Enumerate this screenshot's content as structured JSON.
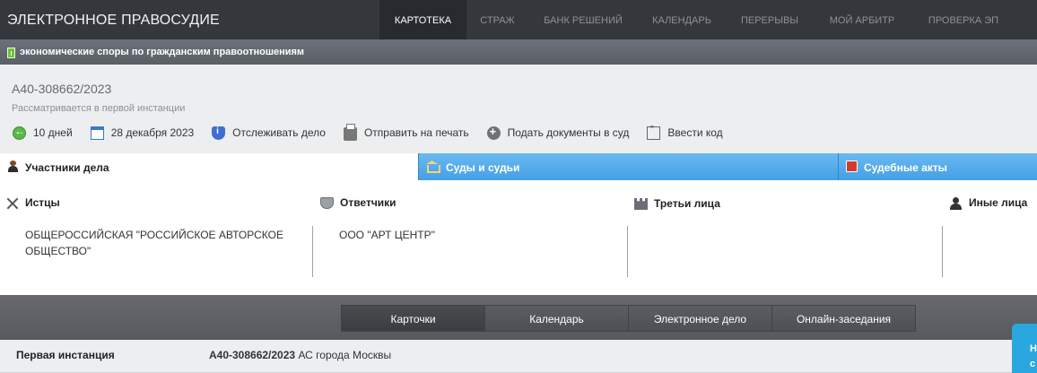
{
  "header": {
    "brand": "ЭЛЕКТРОННОЕ ПРАВОСУДИЕ",
    "nav": [
      {
        "label": "КАРТОТЕКА",
        "active": true
      },
      {
        "label": "СТРАЖ",
        "active": false
      },
      {
        "label": "БАНК РЕШЕНИЙ",
        "active": false
      },
      {
        "label": "КАЛЕНДАРЬ",
        "active": false
      },
      {
        "label": "ПЕРЕРЫВЫ",
        "active": false
      },
      {
        "label": "МОЙ АРБИТР",
        "active": false
      },
      {
        "label": "ПРОВЕРКА ЭП",
        "active": false
      }
    ]
  },
  "category": {
    "label": "экономические споры по гражданским правоотношениям",
    "icon": "document-icon"
  },
  "case": {
    "number": "А40-308662/2023",
    "status": "Рассматривается в первой инстанции",
    "actions": [
      {
        "label": "10 дней",
        "icon": "back-arrow-icon"
      },
      {
        "label": "28 декабря 2023",
        "icon": "calendar-icon"
      },
      {
        "label": "Отслеживать дело",
        "icon": "shield-info-icon"
      },
      {
        "label": "Отправить на печать",
        "icon": "printer-icon"
      },
      {
        "label": "Подать документы в суд",
        "icon": "plus-circle-icon"
      },
      {
        "label": "Ввести код",
        "icon": "code-icon"
      }
    ]
  },
  "tabs": [
    {
      "label": "Участники дела",
      "active": true
    },
    {
      "label": "Суды и судьи",
      "active": false
    },
    {
      "label": "Судебные акты",
      "active": false
    }
  ],
  "parties": {
    "plaintiffs": {
      "title": "Истцы",
      "value": "ОБЩЕРОССИЙСКАЯ \"РОССИЙСКОЕ АВТОРСКОЕ ОБЩЕСТВО\""
    },
    "defendants": {
      "title": "Ответчики",
      "value": "ООО \"АРТ ЦЕНТР\""
    },
    "third": {
      "title": "Третьи лица",
      "value": ""
    },
    "other": {
      "title": "Иные лица",
      "value": ""
    }
  },
  "bottom_tabs": [
    {
      "label": "Карточки",
      "active": true
    },
    {
      "label": "Календарь",
      "active": false
    },
    {
      "label": "Электронное дело",
      "active": false
    },
    {
      "label": "Онлайн-заседания",
      "active": false
    }
  ],
  "instance": {
    "label": "Первая инстанция",
    "case_number": "А40-308662/2023",
    "court": "АС города Москвы"
  },
  "side_widget": {
    "text": "Н\nс"
  },
  "colors": {
    "topbar": "#34373c",
    "tab_blue": "#44a0e6",
    "accent_green": "#6fc03f",
    "widget_blue": "#2aa7de"
  }
}
